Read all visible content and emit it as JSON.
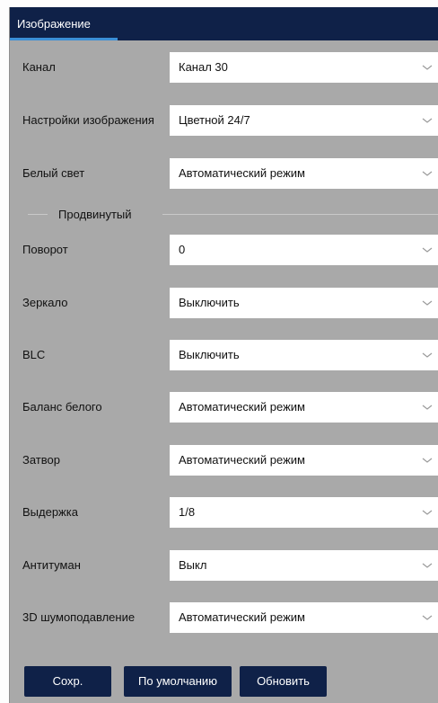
{
  "tab": {
    "label": "Изображение"
  },
  "advanced_label": "Продвинутый",
  "fields_basic": [
    {
      "label": "Канал",
      "value": "Канал 30"
    },
    {
      "label": "Настройки изображения",
      "value": "Цветной 24/7"
    },
    {
      "label": "Белый свет",
      "value": "Автоматический режим"
    }
  ],
  "fields_advanced": [
    {
      "label": "Поворот",
      "value": "0"
    },
    {
      "label": "Зеркало",
      "value": "Выключить"
    },
    {
      "label": "BLC",
      "value": "Выключить"
    },
    {
      "label": "Баланс белого",
      "value": "Автоматический режим"
    },
    {
      "label": "Затвор",
      "value": "Автоматический режим"
    },
    {
      "label": "Выдержка",
      "value": "1/8"
    },
    {
      "label": "Антитуман",
      "value": "Выкл"
    },
    {
      "label": "3D шумоподавление",
      "value": "Автоматический режим"
    }
  ],
  "buttons": {
    "save": "Сохр.",
    "default": "По умолчанию",
    "refresh": "Обновить"
  },
  "icons": {
    "dropdown": "chevron-down-icon"
  },
  "colors": {
    "header_bg": "#0f2148",
    "tab_underline": "#3b8fd6",
    "panel_bg": "#a9a9a9",
    "button_bg": "#0f2148"
  }
}
